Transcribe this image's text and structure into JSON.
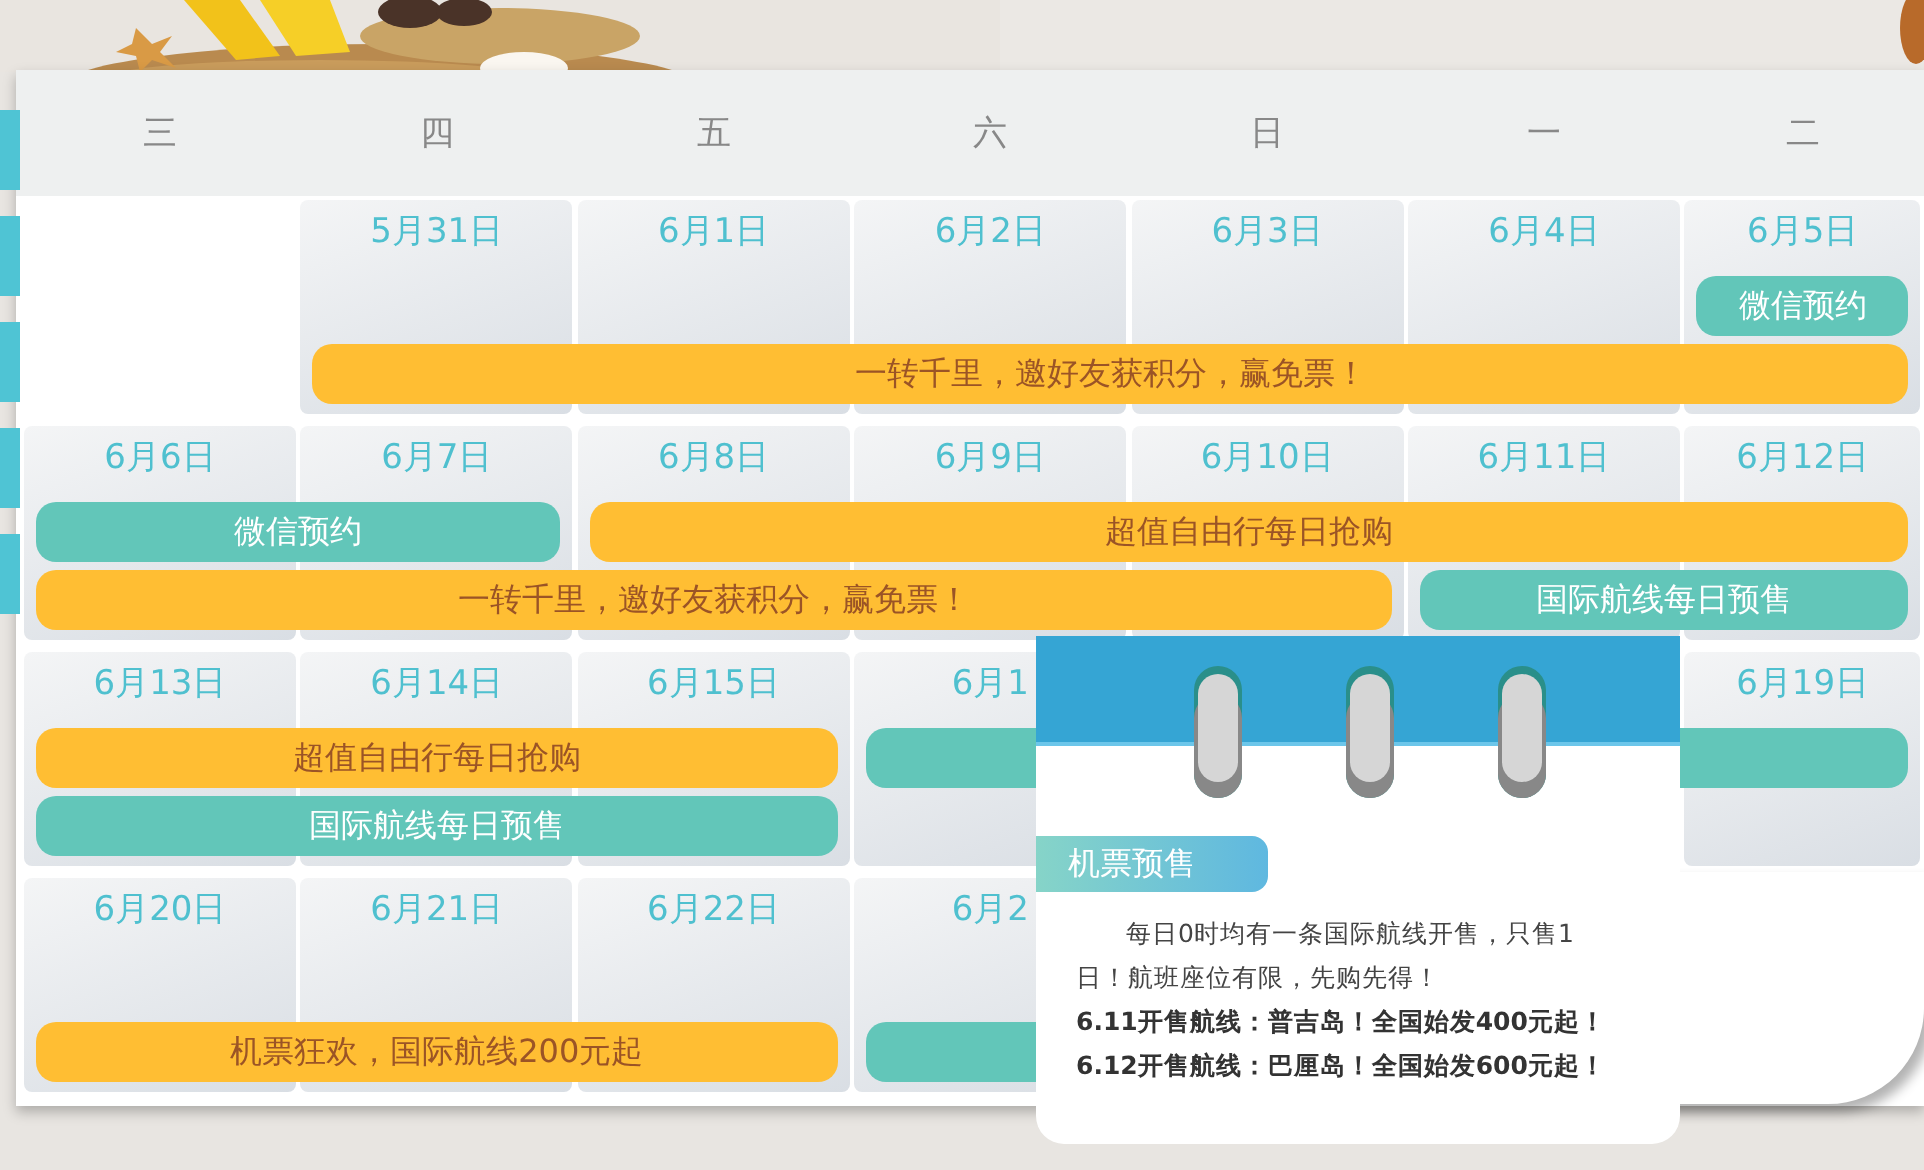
{
  "weekdays": [
    "三",
    "四",
    "五",
    "六",
    "日",
    "一",
    "二"
  ],
  "weeks": [
    {
      "days": [
        {
          "kind": "blank"
        },
        {
          "kind": "day",
          "date": "5月31日"
        },
        {
          "kind": "day",
          "date": "6月1日"
        },
        {
          "kind": "day",
          "date": "6月2日"
        },
        {
          "kind": "day",
          "date": "6月3日"
        },
        {
          "kind": "day",
          "date": "6月4日"
        },
        {
          "kind": "day",
          "date": "6月5日"
        }
      ],
      "lanes": [
        [
          {
            "kind": "gap"
          },
          {
            "kind": "gap"
          },
          {
            "kind": "gap"
          },
          {
            "kind": "gap"
          },
          {
            "kind": "gap"
          },
          {
            "kind": "gap"
          },
          {
            "kind": "presale",
            "label": "微信预约"
          }
        ],
        [
          {
            "kind": "gap"
          },
          {
            "kind": "campaign",
            "label": "一转千里，邀好友获积分，赢免票！"
          },
          {
            "kind": "more"
          },
          {
            "kind": "more"
          },
          {
            "kind": "more"
          },
          {
            "kind": "more"
          },
          {
            "kind": "more"
          }
        ]
      ]
    },
    {
      "days": [
        {
          "kind": "day",
          "date": "6月6日"
        },
        {
          "kind": "day",
          "date": "6月7日"
        },
        {
          "kind": "day",
          "date": "6月8日"
        },
        {
          "kind": "day",
          "date": "6月9日"
        },
        {
          "kind": "day",
          "date": "6月10日"
        },
        {
          "kind": "day",
          "date": "6月11日"
        },
        {
          "kind": "day",
          "date": "6月12日"
        }
      ],
      "lanes": [
        [
          {
            "kind": "presale",
            "label": "微信预约"
          },
          {
            "kind": "more"
          },
          {
            "kind": "campaign",
            "label": "超值自由行每日抢购"
          },
          {
            "kind": "more"
          },
          {
            "kind": "more"
          },
          {
            "kind": "more"
          },
          {
            "kind": "more"
          }
        ],
        [
          {
            "kind": "campaign",
            "label": "一转千里，邀好友获积分，赢免票！"
          },
          {
            "kind": "more"
          },
          {
            "kind": "more"
          },
          {
            "kind": "more"
          },
          {
            "kind": "more"
          },
          {
            "kind": "presale",
            "label": "国际航线每日预售"
          },
          {
            "kind": "more"
          }
        ]
      ]
    },
    {
      "days": [
        {
          "kind": "day",
          "date": "6月13日"
        },
        {
          "kind": "day",
          "date": "6月14日"
        },
        {
          "kind": "day",
          "date": "6月15日"
        },
        {
          "kind": "day",
          "date": "6月1"
        },
        {
          "kind": "day"
        },
        {
          "kind": "day"
        },
        {
          "kind": "day",
          "date": "6月19日"
        }
      ],
      "lanes": [
        [
          {
            "kind": "campaign",
            "label": "超值自由行每日抢购"
          },
          {
            "kind": "more"
          },
          {
            "kind": "more"
          },
          {
            "kind": "presale"
          },
          {
            "kind": "more"
          },
          {
            "kind": "more"
          },
          {
            "kind": "more"
          }
        ],
        [
          {
            "kind": "presale",
            "label": "国际航线每日预售"
          },
          {
            "kind": "more"
          },
          {
            "kind": "more"
          }
        ]
      ]
    },
    {
      "days": [
        {
          "kind": "day",
          "date": "6月20日"
        },
        {
          "kind": "day",
          "date": "6月21日"
        },
        {
          "kind": "day",
          "date": "6月22日"
        },
        {
          "kind": "day",
          "date": "6月2"
        },
        {
          "kind": "day"
        },
        {
          "kind": "day"
        },
        {
          "kind": "blank"
        }
      ],
      "lanes": [
        [
          {
            "kind": "gap"
          }
        ],
        [
          {
            "kind": "campaign",
            "label": "机票狂欢，国际航线200元起"
          },
          {
            "kind": "more"
          },
          {
            "kind": "more"
          },
          {
            "kind": "presale"
          },
          {
            "kind": "more"
          },
          {
            "kind": "more"
          }
        ]
      ]
    }
  ],
  "popup": {
    "tag": "机票预售",
    "text": "每日0时均有一条国际航线开售，只售1日！航班座位有限，先购先得！",
    "lines": [
      "6.11开售航线：普吉岛！全国始发400元起！",
      "6.12开售航线：巴厘岛！全国始发600元起！"
    ]
  }
}
